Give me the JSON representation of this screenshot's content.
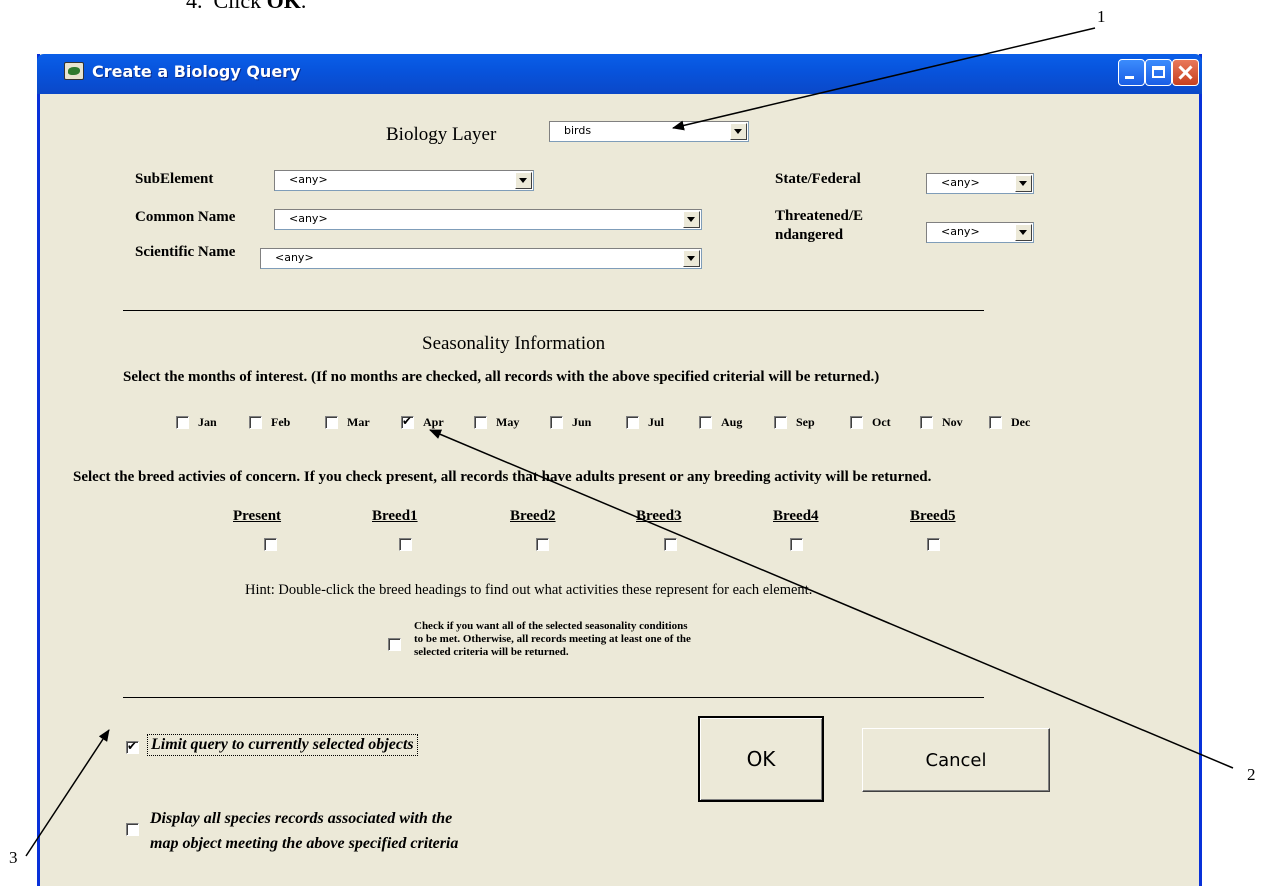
{
  "doc_step": "4.  Click OK.",
  "callouts": [
    "1",
    "2",
    "3"
  ],
  "window": {
    "title": "Create a Biology Query",
    "buttons": [
      "minimize",
      "maximize",
      "close"
    ]
  },
  "biology_layer": {
    "label": "Biology Layer",
    "value": "birds"
  },
  "fields": {
    "subelement": {
      "label": "SubElement",
      "value": "<any>"
    },
    "common_name": {
      "label": "Common Name",
      "value": "<any>"
    },
    "scientific_name": {
      "label": "Scientific Name",
      "value": "<any>"
    },
    "state_federal": {
      "label": "State/Federal",
      "value": "<any>"
    },
    "threatened_line1": "Threatened/E",
    "threatened_line2": "ndangered",
    "threatened_value": "<any>"
  },
  "seasonality": {
    "heading": "Seasonality Information",
    "instruction": "Select the months of interest. (If no months are checked, all records with the above specified criterial will be returned.)",
    "months": [
      {
        "label": "Jan",
        "checked": false
      },
      {
        "label": "Feb",
        "checked": false
      },
      {
        "label": "Mar",
        "checked": false
      },
      {
        "label": "Apr",
        "checked": true
      },
      {
        "label": "May",
        "checked": false
      },
      {
        "label": "Jun",
        "checked": false
      },
      {
        "label": "Jul",
        "checked": false
      },
      {
        "label": "Aug",
        "checked": false
      },
      {
        "label": "Sep",
        "checked": false
      },
      {
        "label": "Oct",
        "checked": false
      },
      {
        "label": "Nov",
        "checked": false
      },
      {
        "label": "Dec",
        "checked": false
      }
    ],
    "breed_instruction": "Select the breed activies of concern. If you check present, all records that have adults present or any breeding activity will be returned.",
    "breeds": [
      {
        "label": "Present",
        "checked": false
      },
      {
        "label": "Breed1",
        "checked": false
      },
      {
        "label": "Breed2",
        "checked": false
      },
      {
        "label": "Breed3",
        "checked": false
      },
      {
        "label": "Breed4",
        "checked": false
      },
      {
        "label": "Breed5",
        "checked": false
      }
    ],
    "hint": "Hint:  Double-click the breed headings to find out what activities these represent for each element.",
    "all_conditions_line1": "Check if you want all of the selected seasonality conditions",
    "all_conditions_line2": "to be met. Otherwise, all records meeting at least one of the",
    "all_conditions_line3": "selected criteria will be returned.",
    "all_conditions_checked": false
  },
  "options": {
    "limit_query": {
      "label": "Limit query to currently selected objects",
      "checked": true
    },
    "display_all_line1": "Display all species records associated with the",
    "display_all_line2": "map object meeting the above specified criteria",
    "display_all_checked": false
  },
  "buttons": {
    "ok": "OK",
    "cancel": "Cancel"
  }
}
